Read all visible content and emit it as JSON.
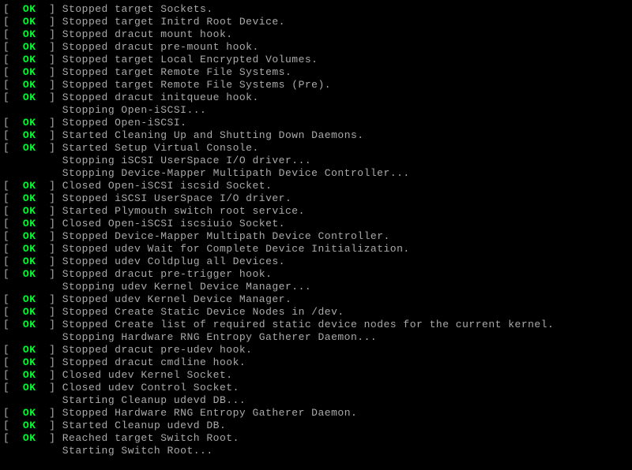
{
  "brackets": {
    "open": "[  ",
    "close": "  ] "
  },
  "ok_label": "OK",
  "indent_prefix": "         ",
  "lines": [
    {
      "type": "status",
      "msg": "Stopped target Sockets."
    },
    {
      "type": "status",
      "msg": "Stopped target Initrd Root Device."
    },
    {
      "type": "status",
      "msg": "Stopped dracut mount hook."
    },
    {
      "type": "status",
      "msg": "Stopped dracut pre-mount hook."
    },
    {
      "type": "status",
      "msg": "Stopped target Local Encrypted Volumes."
    },
    {
      "type": "status",
      "msg": "Stopped target Remote File Systems."
    },
    {
      "type": "status",
      "msg": "Stopped target Remote File Systems (Pre)."
    },
    {
      "type": "status",
      "msg": "Stopped dracut initqueue hook."
    },
    {
      "type": "plain",
      "msg": "Stopping Open-iSCSI..."
    },
    {
      "type": "status",
      "msg": "Stopped Open-iSCSI."
    },
    {
      "type": "status",
      "msg": "Started Cleaning Up and Shutting Down Daemons."
    },
    {
      "type": "status",
      "msg": "Started Setup Virtual Console."
    },
    {
      "type": "plain",
      "msg": "Stopping iSCSI UserSpace I/O driver..."
    },
    {
      "type": "plain",
      "msg": "Stopping Device-Mapper Multipath Device Controller..."
    },
    {
      "type": "status",
      "msg": "Closed Open-iSCSI iscsid Socket."
    },
    {
      "type": "status",
      "msg": "Stopped iSCSI UserSpace I/O driver."
    },
    {
      "type": "status",
      "msg": "Started Plymouth switch root service."
    },
    {
      "type": "status",
      "msg": "Closed Open-iSCSI iscsiuio Socket."
    },
    {
      "type": "status",
      "msg": "Stopped Device-Mapper Multipath Device Controller."
    },
    {
      "type": "status",
      "msg": "Stopped udev Wait for Complete Device Initialization."
    },
    {
      "type": "status",
      "msg": "Stopped udev Coldplug all Devices."
    },
    {
      "type": "status",
      "msg": "Stopped dracut pre-trigger hook."
    },
    {
      "type": "plain",
      "msg": "Stopping udev Kernel Device Manager..."
    },
    {
      "type": "status",
      "msg": "Stopped udev Kernel Device Manager."
    },
    {
      "type": "status",
      "msg": "Stopped Create Static Device Nodes in /dev."
    },
    {
      "type": "status",
      "msg": "Stopped Create list of required static device nodes for the current kernel."
    },
    {
      "type": "plain",
      "msg": "Stopping Hardware RNG Entropy Gatherer Daemon..."
    },
    {
      "type": "status",
      "msg": "Stopped dracut pre-udev hook."
    },
    {
      "type": "status",
      "msg": "Stopped dracut cmdline hook."
    },
    {
      "type": "status",
      "msg": "Closed udev Kernel Socket."
    },
    {
      "type": "status",
      "msg": "Closed udev Control Socket."
    },
    {
      "type": "plain",
      "msg": "Starting Cleanup udevd DB..."
    },
    {
      "type": "status",
      "msg": "Stopped Hardware RNG Entropy Gatherer Daemon."
    },
    {
      "type": "status",
      "msg": "Started Cleanup udevd DB."
    },
    {
      "type": "status",
      "msg": "Reached target Switch Root."
    },
    {
      "type": "plain",
      "msg": "Starting Switch Root..."
    }
  ]
}
